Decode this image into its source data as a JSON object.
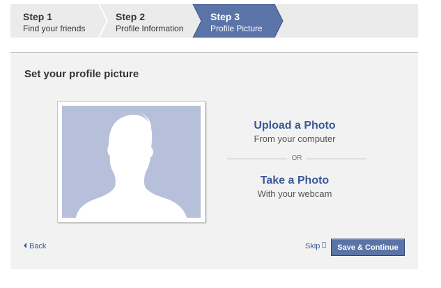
{
  "steps": [
    {
      "number": "Step 1",
      "label": "Find your friends",
      "active": false
    },
    {
      "number": "Step 2",
      "label": "Profile Information",
      "active": false
    },
    {
      "number": "Step 3",
      "label": "Profile Picture",
      "active": true
    }
  ],
  "panel": {
    "title": "Set your profile picture"
  },
  "options": {
    "upload_title": "Upload a Photo",
    "upload_desc": "From your computer",
    "or_text": "OR",
    "webcam_title": "Take a Photo",
    "webcam_desc": "With your webcam"
  },
  "footer": {
    "back_label": "Back",
    "skip_label": "Skip",
    "save_label": "Save & Continue"
  },
  "colors": {
    "accent": "#3b5998",
    "active_step": "#5b74a8",
    "silhouette_bg": "#b7c0da"
  }
}
